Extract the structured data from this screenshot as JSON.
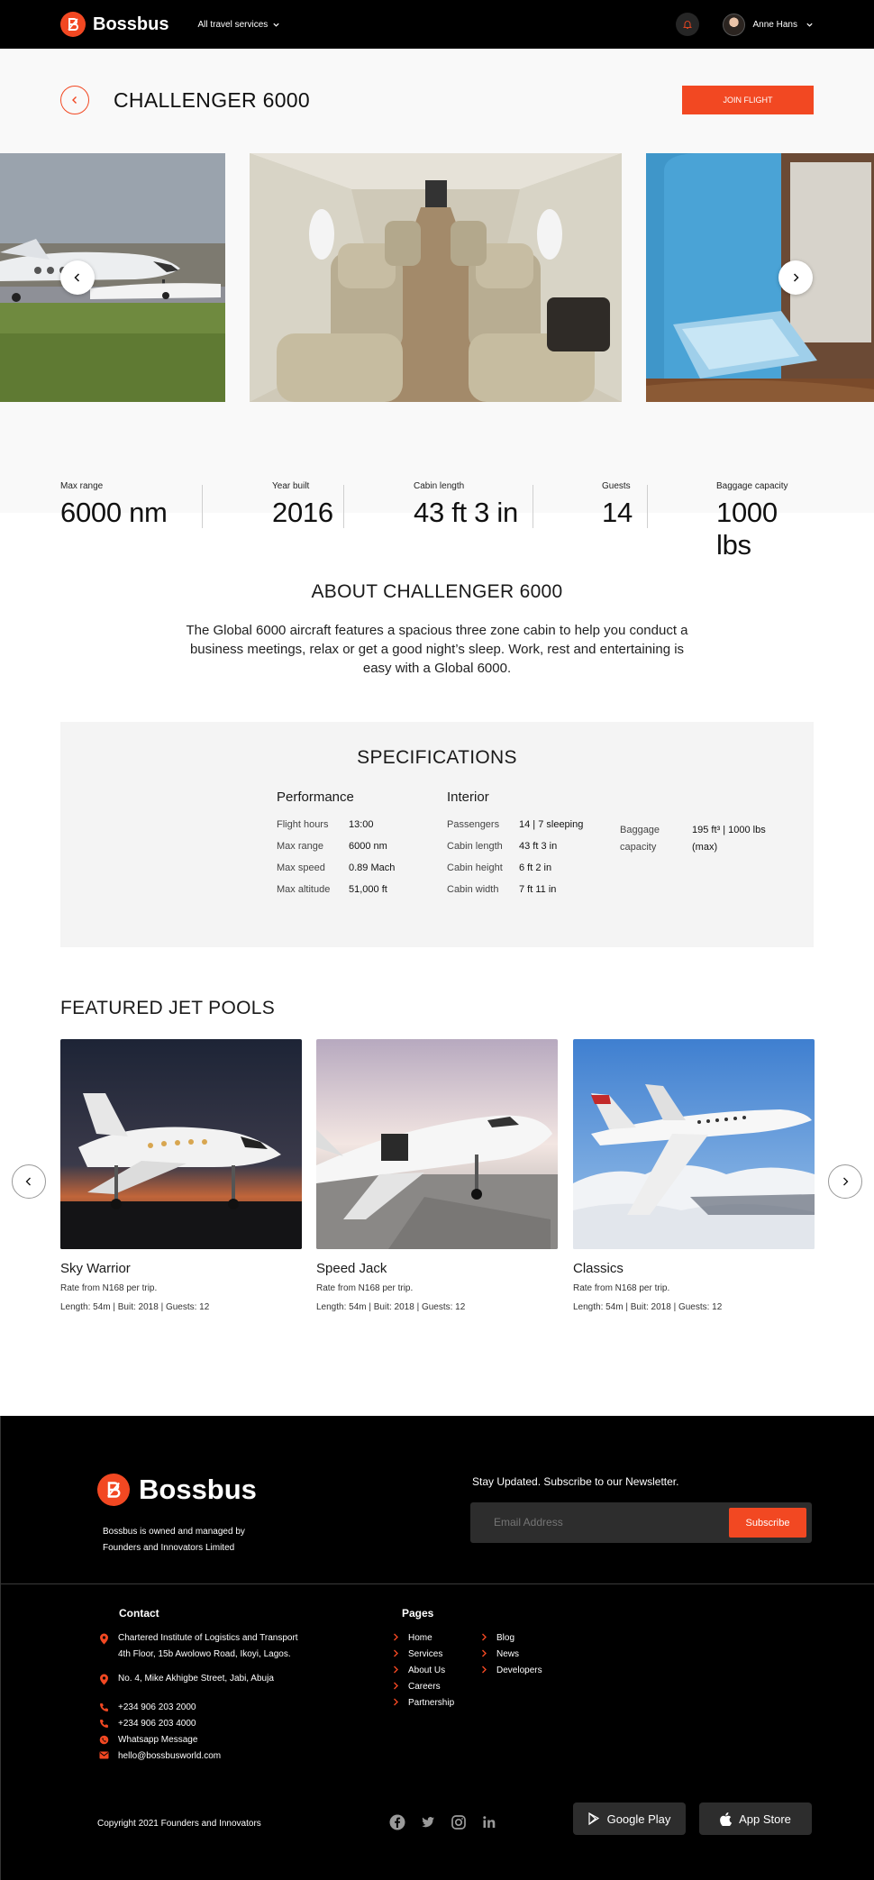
{
  "nav": {
    "brand": "Bossbus",
    "services": "All travel services",
    "user_name": "Anne Hans"
  },
  "header": {
    "title": "CHALLENGER 6000",
    "join_label": "JOIN FLIGHT"
  },
  "stats": [
    {
      "label": "Max range",
      "value": "6000 nm"
    },
    {
      "label": "Year built",
      "value": "2016"
    },
    {
      "label": "Cabin length",
      "value": "43 ft 3 in"
    },
    {
      "label": "Guests",
      "value": "14"
    },
    {
      "label": "Baggage capacity",
      "value": "1000 lbs"
    }
  ],
  "about": {
    "title": "ABOUT CHALLENGER 6000",
    "text": "The Global 6000 aircraft features a spacious three zone cabin to help you conduct a business meetings, relax or get a good night’s sleep. Work, rest and entertaining is easy with a Global 6000."
  },
  "specs": {
    "title": "SPECIFICATIONS",
    "performance": {
      "title": "Performance",
      "rows": [
        {
          "k": "Flight hours",
          "v": "13:00"
        },
        {
          "k": "Max range",
          "v": "6000 nm"
        },
        {
          "k": "Max speed",
          "v": "0.89 Mach"
        },
        {
          "k": "Max altitude",
          "v": "51,000 ft"
        }
      ]
    },
    "interior": {
      "title": "Interior",
      "rows": [
        {
          "k": "Passengers",
          "v": "14 | 7 sleeping"
        },
        {
          "k": "Cabin length",
          "v": "43 ft 3 in"
        },
        {
          "k": "Cabin height",
          "v": "6 ft 2 in"
        },
        {
          "k": "Cabin width",
          "v": "7 ft 11 in"
        }
      ],
      "baggage_key_1": "Baggage",
      "baggage_key_2": "capacity",
      "baggage_val_1": "195 ft³ | 1000 lbs",
      "baggage_val_2": "(max)"
    }
  },
  "featured": {
    "title": "FEATURED JET POOLS",
    "cards": [
      {
        "name": "Sky Warrior",
        "rate": "Rate from N168 per trip.",
        "meta": "Length: 54m | Buit: 2018 | Guests: 12"
      },
      {
        "name": "Speed Jack",
        "rate": "Rate from N168 per trip.",
        "meta": "Length: 54m | Buit: 2018 | Guests: 12"
      },
      {
        "name": "Classics",
        "rate": "Rate from N168 per trip.",
        "meta": "Length: 54m | Buit: 2018 | Guests: 12"
      }
    ]
  },
  "footer": {
    "brand": "Bossbus",
    "tagline_1": "Bossbus is owned and managed by",
    "tagline_2": "Founders and Innovators Limited",
    "newsletter_title": "Stay Updated. Subscribe to our Newsletter.",
    "email_placeholder": "Email Address",
    "subscribe_label": "Subscribe",
    "contact_title": "Contact",
    "address_1a": "Chartered Institute of Logistics and Transport",
    "address_1b": "4th Floor, 15b Awolowo Road, Ikoyi, Lagos.",
    "address_2": "No. 4, Mike Akhigbe Street, Jabi, Abuja",
    "phone_1": "+234 906 203 2000",
    "phone_2": "+234 906 203 4000",
    "whatsapp": "Whatsapp Message",
    "email": "hello@bossbusworld.com",
    "pages_title": "Pages",
    "pages_col1": [
      "Home",
      "Services",
      "About Us",
      "Careers",
      "Partnership"
    ],
    "pages_col2": [
      "Blog",
      "News",
      "Developers"
    ],
    "copyright": "Copyright 2021 Founders and Innovators",
    "google_play": "Google Play",
    "app_store": "App Store"
  },
  "colors": {
    "accent": "#f24822",
    "nav_bg": "#000000",
    "panel_bg": "#f4f4f4"
  }
}
